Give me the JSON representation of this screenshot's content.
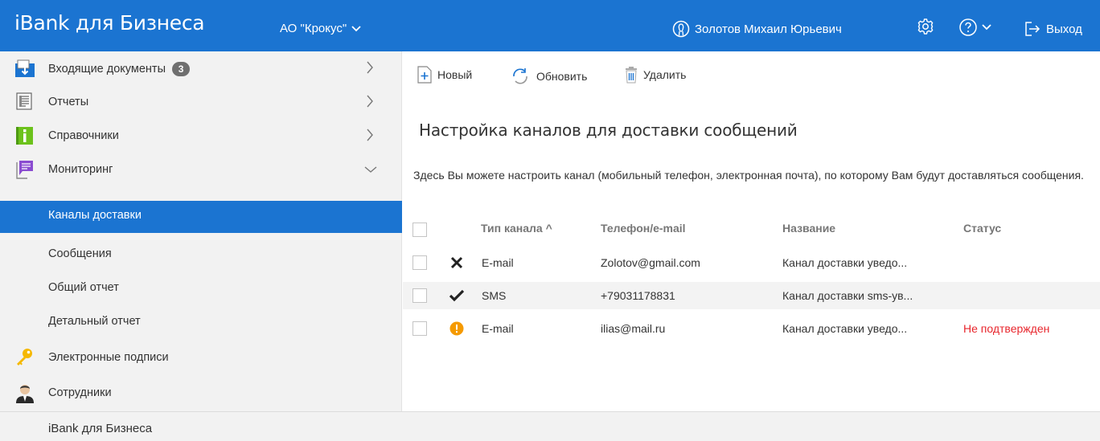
{
  "header": {
    "app_title": "iBank для Бизнеса",
    "org_name": "АО \"Крокус\"",
    "user_name": "Золотов Михаил Юрьевич",
    "logout_label": "Выход",
    "brand_color": "#1b74d1",
    "icons": [
      "user-icon",
      "gear-icon",
      "help-icon",
      "logout-icon"
    ]
  },
  "sidebar": {
    "items": [
      {
        "label": "Входящие документы",
        "badge": "3",
        "icon": "incoming-docs-icon"
      },
      {
        "label": "Отчеты",
        "icon": "reports-icon"
      },
      {
        "label": "Справочники",
        "icon": "directories-icon"
      },
      {
        "label": "Мониторинг",
        "icon": "monitoring-icon"
      }
    ],
    "sub_items": [
      {
        "label": "Каналы доставки",
        "active": true
      },
      {
        "label": "Сообщения"
      },
      {
        "label": "Общий отчет"
      },
      {
        "label": "Детальный отчет"
      }
    ],
    "items_after": [
      {
        "label": "Электронные подписи",
        "icon": "key-icon"
      },
      {
        "label": "Сотрудники",
        "icon": "employee-icon"
      }
    ]
  },
  "toolbar": {
    "new_label": "Новый",
    "refresh_label": "Обновить",
    "delete_label": "Удалить"
  },
  "main": {
    "title": "Настройка каналов для доставки сообщений",
    "description": "Здесь Вы можете настроить канал (мобильный телефон, электронная почта), по которому Вам будут доставляться сообщения."
  },
  "table": {
    "columns": [
      "Тип канала ^",
      "Телефон/e-mail",
      "Название",
      "Статус"
    ],
    "rows": [
      {
        "state_icon": "cross-icon",
        "type": "E-mail",
        "contact": "Zolotov@gmail.com",
        "name": "Канал доставки уведо...",
        "status": ""
      },
      {
        "state_icon": "check-icon",
        "type": "SMS",
        "contact": "+79031178831",
        "name": "Канал доставки sms-ув...",
        "status": ""
      },
      {
        "state_icon": "warning-icon",
        "type": "E-mail",
        "contact": "ilias@mail.ru",
        "name": "Канал доставки уведо...",
        "status": "Не подтвержден"
      }
    ]
  },
  "footer": {
    "text": "iBank для Бизнеса"
  }
}
